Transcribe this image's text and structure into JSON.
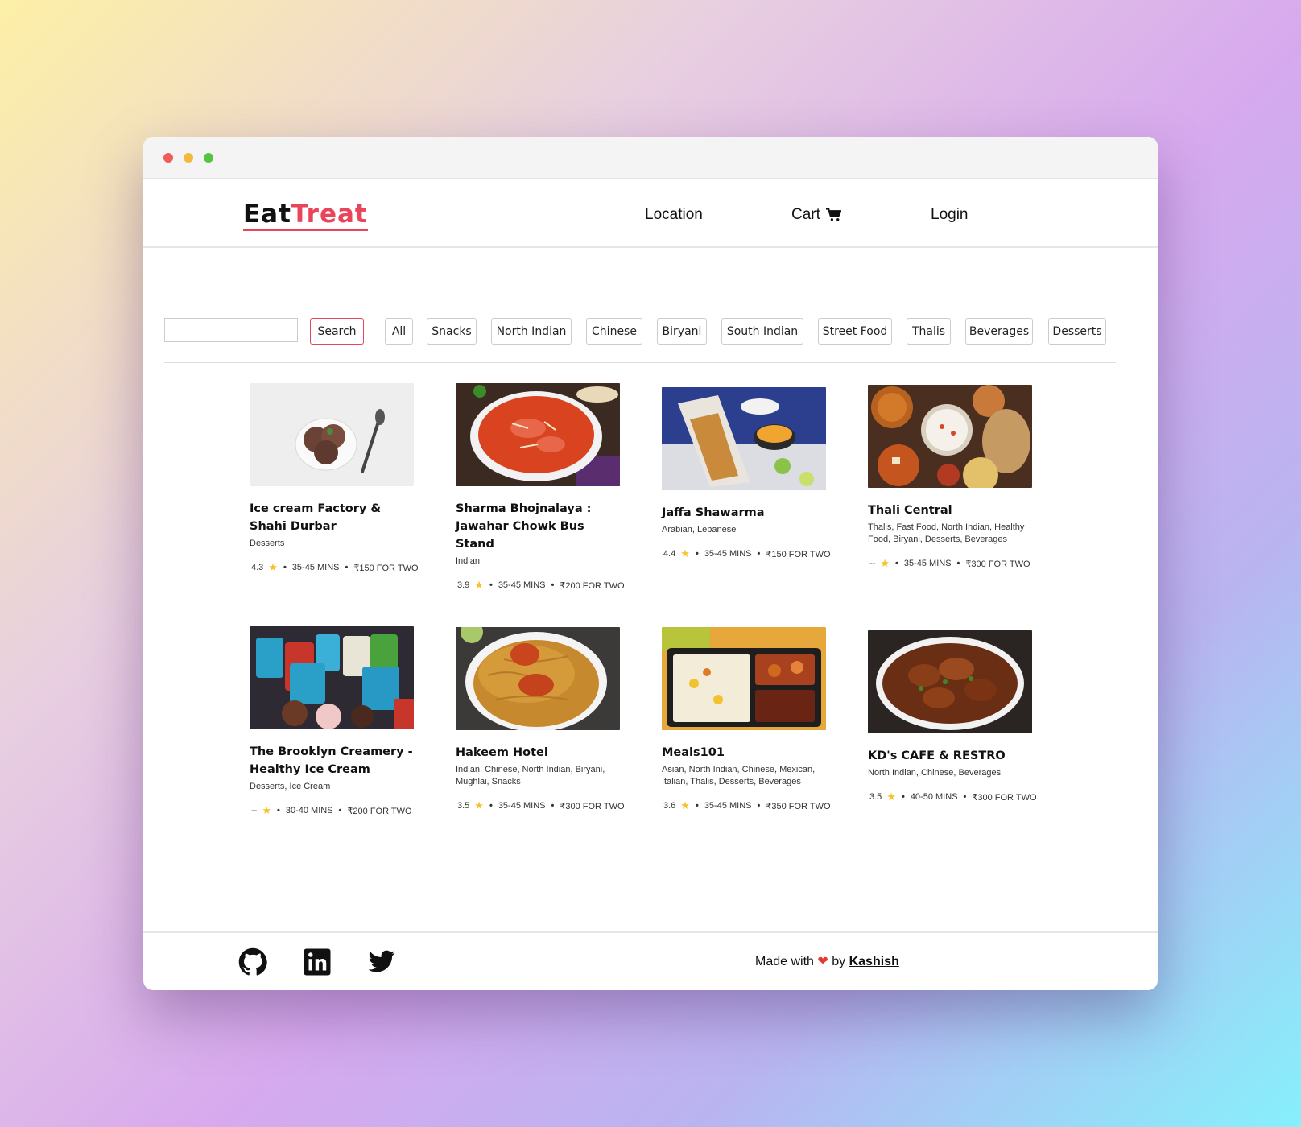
{
  "brand": {
    "eat": "Eat",
    "treat": "Treat"
  },
  "nav": {
    "location": "Location",
    "cart": "Cart",
    "login": "Login"
  },
  "search": {
    "value": "",
    "button": "Search"
  },
  "categories": [
    "All",
    "Snacks",
    "North Indian",
    "Chinese",
    "Biryani",
    "South Indian",
    "Street Food",
    "Thalis",
    "Beverages",
    "Desserts"
  ],
  "restaurants": [
    {
      "name": "Ice cream Factory & Shahi Durbar",
      "cuisine": "Desserts",
      "rating": "4.3",
      "time": "35-45 MINS",
      "cost": "₹150 FOR TWO"
    },
    {
      "name": "Sharma Bhojnalaya : Jawahar Chowk Bus Stand",
      "cuisine": "Indian",
      "rating": "3.9",
      "time": "35-45 MINS",
      "cost": "₹200 FOR TWO"
    },
    {
      "name": "Jaffa Shawarma",
      "cuisine": "Arabian, Lebanese",
      "rating": "4.4",
      "time": "35-45 MINS",
      "cost": "₹150 FOR TWO"
    },
    {
      "name": "Thali Central",
      "cuisine": "Thalis, Fast Food, North Indian, Healthy Food, Biryani, Desserts, Beverages",
      "rating": "--",
      "time": "35-45 MINS",
      "cost": "₹300 FOR TWO"
    },
    {
      "name": "The Brooklyn Creamery - Healthy Ice Cream",
      "cuisine": "Desserts, Ice Cream",
      "rating": "--",
      "time": "30-40 MINS",
      "cost": "₹200 FOR TWO"
    },
    {
      "name": "Hakeem Hotel",
      "cuisine": "Indian, Chinese, North Indian, Biryani, Mughlai, Snacks",
      "rating": "3.5",
      "time": "35-45 MINS",
      "cost": "₹300 FOR TWO"
    },
    {
      "name": "Meals101",
      "cuisine": "Asian, North Indian, Chinese, Mexican, Italian, Thalis, Desserts, Beverages",
      "rating": "3.6",
      "time": "35-45 MINS",
      "cost": "₹350 FOR TWO"
    },
    {
      "name": "KD's CAFE & RESTRO",
      "cuisine": "North Indian, Chinese, Beverages",
      "rating": "3.5",
      "time": "40-50 MINS",
      "cost": "₹300 FOR TWO"
    }
  ],
  "footer": {
    "made_with": "Made with",
    "by": "by",
    "author": "Kashish"
  },
  "colors": {
    "accent": "#e8445a",
    "star": "#f7c12a"
  }
}
